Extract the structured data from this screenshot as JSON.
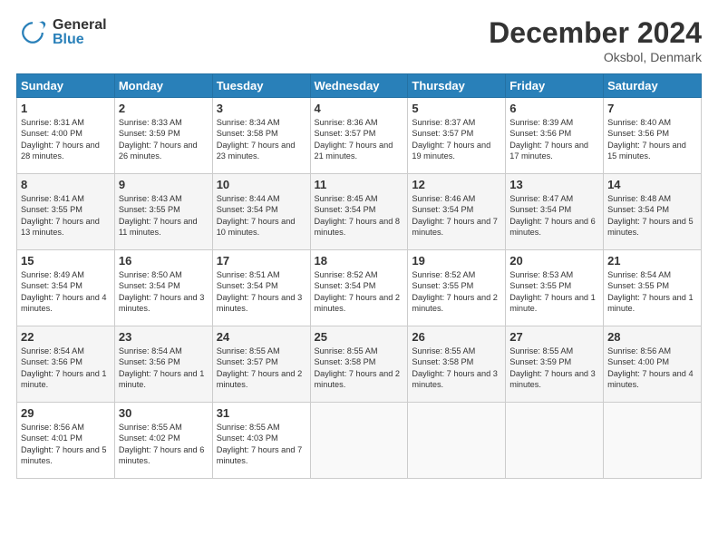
{
  "header": {
    "logo_general": "General",
    "logo_blue": "Blue",
    "month": "December 2024",
    "location": "Oksbol, Denmark"
  },
  "days_of_week": [
    "Sunday",
    "Monday",
    "Tuesday",
    "Wednesday",
    "Thursday",
    "Friday",
    "Saturday"
  ],
  "weeks": [
    [
      {
        "day": "1",
        "sunrise": "8:31 AM",
        "sunset": "4:00 PM",
        "daylight": "7 hours and 28 minutes."
      },
      {
        "day": "2",
        "sunrise": "8:33 AM",
        "sunset": "3:59 PM",
        "daylight": "7 hours and 26 minutes."
      },
      {
        "day": "3",
        "sunrise": "8:34 AM",
        "sunset": "3:58 PM",
        "daylight": "7 hours and 23 minutes."
      },
      {
        "day": "4",
        "sunrise": "8:36 AM",
        "sunset": "3:57 PM",
        "daylight": "7 hours and 21 minutes."
      },
      {
        "day": "5",
        "sunrise": "8:37 AM",
        "sunset": "3:57 PM",
        "daylight": "7 hours and 19 minutes."
      },
      {
        "day": "6",
        "sunrise": "8:39 AM",
        "sunset": "3:56 PM",
        "daylight": "7 hours and 17 minutes."
      },
      {
        "day": "7",
        "sunrise": "8:40 AM",
        "sunset": "3:56 PM",
        "daylight": "7 hours and 15 minutes."
      }
    ],
    [
      {
        "day": "8",
        "sunrise": "8:41 AM",
        "sunset": "3:55 PM",
        "daylight": "7 hours and 13 minutes."
      },
      {
        "day": "9",
        "sunrise": "8:43 AM",
        "sunset": "3:55 PM",
        "daylight": "7 hours and 11 minutes."
      },
      {
        "day": "10",
        "sunrise": "8:44 AM",
        "sunset": "3:54 PM",
        "daylight": "7 hours and 10 minutes."
      },
      {
        "day": "11",
        "sunrise": "8:45 AM",
        "sunset": "3:54 PM",
        "daylight": "7 hours and 8 minutes."
      },
      {
        "day": "12",
        "sunrise": "8:46 AM",
        "sunset": "3:54 PM",
        "daylight": "7 hours and 7 minutes."
      },
      {
        "day": "13",
        "sunrise": "8:47 AM",
        "sunset": "3:54 PM",
        "daylight": "7 hours and 6 minutes."
      },
      {
        "day": "14",
        "sunrise": "8:48 AM",
        "sunset": "3:54 PM",
        "daylight": "7 hours and 5 minutes."
      }
    ],
    [
      {
        "day": "15",
        "sunrise": "8:49 AM",
        "sunset": "3:54 PM",
        "daylight": "7 hours and 4 minutes."
      },
      {
        "day": "16",
        "sunrise": "8:50 AM",
        "sunset": "3:54 PM",
        "daylight": "7 hours and 3 minutes."
      },
      {
        "day": "17",
        "sunrise": "8:51 AM",
        "sunset": "3:54 PM",
        "daylight": "7 hours and 3 minutes."
      },
      {
        "day": "18",
        "sunrise": "8:52 AM",
        "sunset": "3:54 PM",
        "daylight": "7 hours and 2 minutes."
      },
      {
        "day": "19",
        "sunrise": "8:52 AM",
        "sunset": "3:55 PM",
        "daylight": "7 hours and 2 minutes."
      },
      {
        "day": "20",
        "sunrise": "8:53 AM",
        "sunset": "3:55 PM",
        "daylight": "7 hours and 1 minute."
      },
      {
        "day": "21",
        "sunrise": "8:54 AM",
        "sunset": "3:55 PM",
        "daylight": "7 hours and 1 minute."
      }
    ],
    [
      {
        "day": "22",
        "sunrise": "8:54 AM",
        "sunset": "3:56 PM",
        "daylight": "7 hours and 1 minute."
      },
      {
        "day": "23",
        "sunrise": "8:54 AM",
        "sunset": "3:56 PM",
        "daylight": "7 hours and 1 minute."
      },
      {
        "day": "24",
        "sunrise": "8:55 AM",
        "sunset": "3:57 PM",
        "daylight": "7 hours and 2 minutes."
      },
      {
        "day": "25",
        "sunrise": "8:55 AM",
        "sunset": "3:58 PM",
        "daylight": "7 hours and 2 minutes."
      },
      {
        "day": "26",
        "sunrise": "8:55 AM",
        "sunset": "3:58 PM",
        "daylight": "7 hours and 3 minutes."
      },
      {
        "day": "27",
        "sunrise": "8:55 AM",
        "sunset": "3:59 PM",
        "daylight": "7 hours and 3 minutes."
      },
      {
        "day": "28",
        "sunrise": "8:56 AM",
        "sunset": "4:00 PM",
        "daylight": "7 hours and 4 minutes."
      }
    ],
    [
      {
        "day": "29",
        "sunrise": "8:56 AM",
        "sunset": "4:01 PM",
        "daylight": "7 hours and 5 minutes."
      },
      {
        "day": "30",
        "sunrise": "8:55 AM",
        "sunset": "4:02 PM",
        "daylight": "7 hours and 6 minutes."
      },
      {
        "day": "31",
        "sunrise": "8:55 AM",
        "sunset": "4:03 PM",
        "daylight": "7 hours and 7 minutes."
      },
      null,
      null,
      null,
      null
    ]
  ],
  "labels": {
    "sunrise": "Sunrise:",
    "sunset": "Sunset:",
    "daylight": "Daylight:"
  }
}
